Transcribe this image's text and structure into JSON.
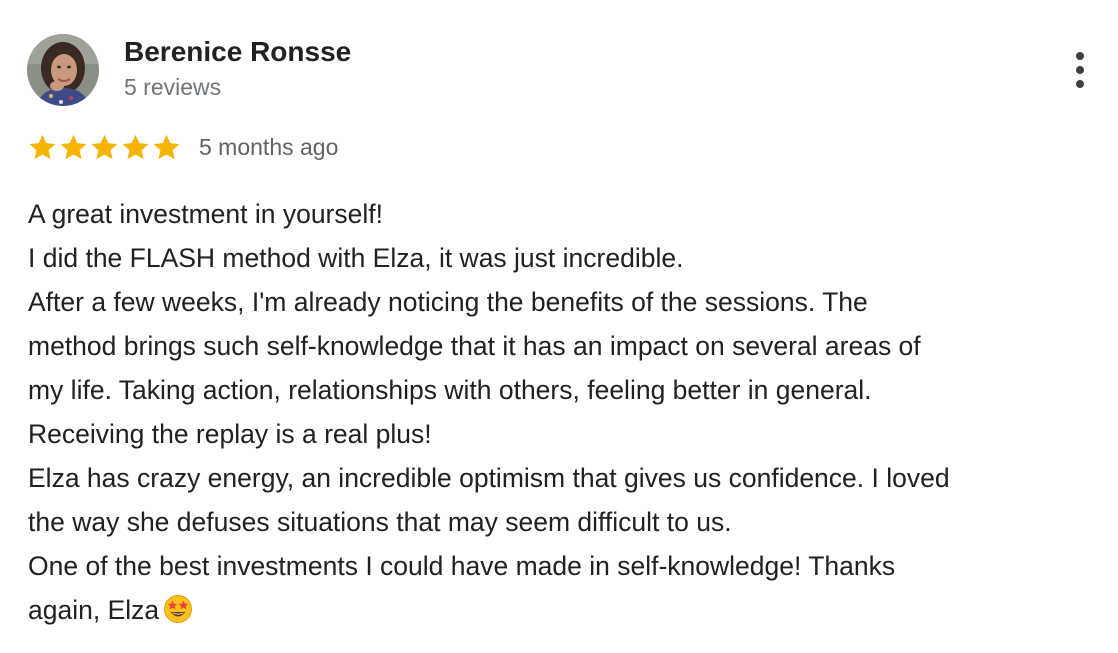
{
  "review": {
    "author": {
      "name": "Berenice Ronsse",
      "reviews_count": "5 reviews"
    },
    "rating": 5,
    "max_rating": 5,
    "time_ago": "5 months ago",
    "menu_icon": "more-vert-icon",
    "body_lines": [
      "A great investment in yourself!",
      "I did the FLASH method with Elza, it was just incredible.",
      "After a few weeks, I'm already noticing the benefits of the sessions. The",
      "method brings such self-knowledge that it has an impact on several areas of",
      "my life. Taking action, relationships with others, feeling better in general.",
      "Receiving the replay is a real plus!",
      "Elza has crazy energy, an incredible optimism that gives us confidence. I loved",
      "the way she defuses situations that may seem difficult to us.",
      "One of the best investments I could have made in self-knowledge! Thanks",
      "again, Elza"
    ],
    "trailing_emoji": "star-struck-emoji"
  },
  "colors": {
    "star": "#f4b400",
    "name": "#202124",
    "meta": "#70757a"
  }
}
